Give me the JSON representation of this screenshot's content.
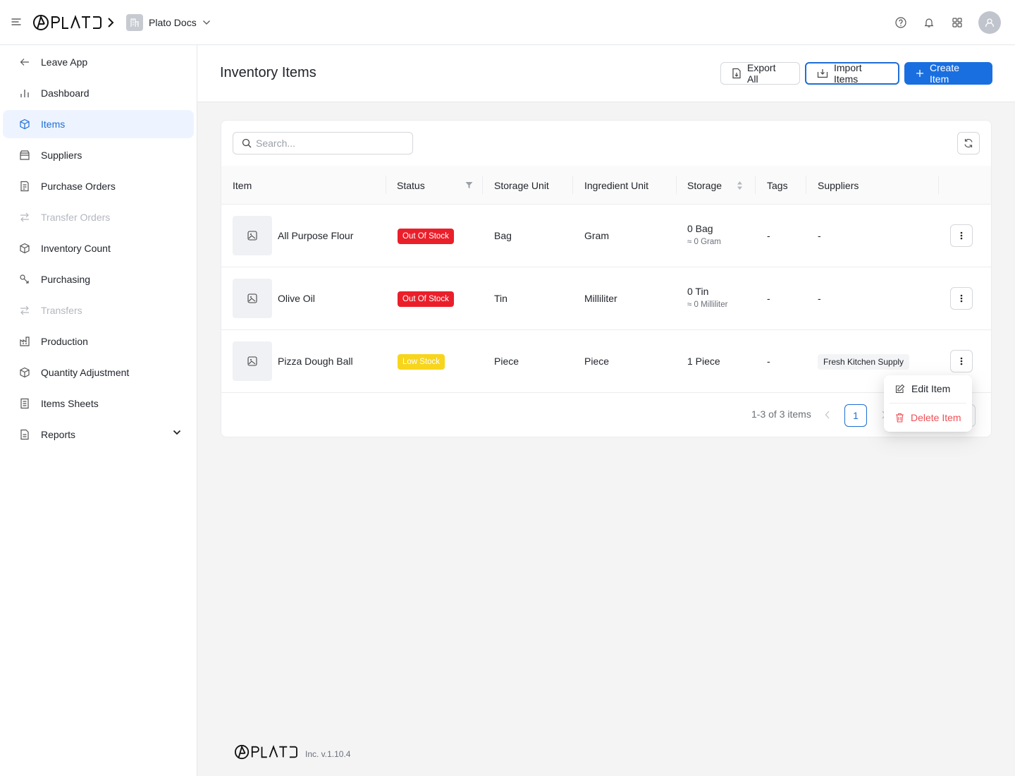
{
  "header": {
    "brand": "PLATO",
    "org_name": "Plato Docs"
  },
  "sidebar": {
    "items": [
      {
        "label": "Leave App"
      },
      {
        "label": "Dashboard"
      },
      {
        "label": "Items"
      },
      {
        "label": "Suppliers"
      },
      {
        "label": "Purchase Orders"
      },
      {
        "label": "Transfer Orders"
      },
      {
        "label": "Inventory Count"
      },
      {
        "label": "Purchasing"
      },
      {
        "label": "Transfers"
      },
      {
        "label": "Production"
      },
      {
        "label": "Quantity Adjustment"
      },
      {
        "label": "Items Sheets"
      },
      {
        "label": "Reports"
      }
    ]
  },
  "page": {
    "title": "Inventory Items",
    "export_label": "Export All",
    "import_label": "Import Items",
    "create_label": "Create Item"
  },
  "search": {
    "placeholder": "Search..."
  },
  "table": {
    "columns": [
      "Item",
      "Status",
      "Storage Unit",
      "Ingredient Unit",
      "Storage",
      "Tags",
      "Suppliers"
    ],
    "rows": [
      {
        "name": "All Purpose Flour",
        "status": "Out Of Stock",
        "storage_unit": "Bag",
        "ingredient_unit": "Gram",
        "storage": "0 Bag",
        "storage_sub": "≈ 0 Gram",
        "tags": "-",
        "suppliers": "-"
      },
      {
        "name": "Olive Oil",
        "status": "Out Of Stock",
        "storage_unit": "Tin",
        "ingredient_unit": "Milliliter",
        "storage": "0 Tin",
        "storage_sub": "≈ 0 Milliliter",
        "tags": "-",
        "suppliers": "-"
      },
      {
        "name": "Pizza Dough Ball",
        "status": "Low Stock",
        "storage_unit": "Piece",
        "ingredient_unit": "Piece",
        "storage": "1 Piece",
        "storage_sub": "",
        "tags": "-",
        "suppliers": "Fresh Kitchen Supply"
      }
    ]
  },
  "pagination": {
    "summary": "1-3 of 3 items",
    "current_page": "1"
  },
  "row_menu": {
    "edit_label": "Edit Item",
    "delete_label": "Delete Item"
  },
  "footer": {
    "brand": "PLATO",
    "version": "Inc. v.1.10.4"
  },
  "colors": {
    "primary": "#1a6fe0",
    "out_of_stock": "#ea1f2a",
    "low_stock": "#f7d51c",
    "danger_text": "#f04e54",
    "active_nav_bg": "#edf4ff"
  }
}
